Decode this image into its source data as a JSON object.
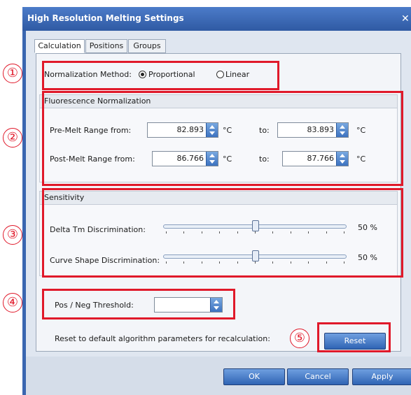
{
  "window": {
    "title": "High Resolution Melting Settings",
    "close": "✕"
  },
  "tabs": [
    {
      "label": "Calculation"
    },
    {
      "label": "Positions"
    },
    {
      "label": "Groups"
    }
  ],
  "normalization": {
    "label": "Normalization Method:",
    "options": [
      {
        "label": "Proportional",
        "selected": true
      },
      {
        "label": "Linear",
        "selected": false
      }
    ]
  },
  "fluorescence": {
    "header": "Fluorescence  Normalization",
    "premelt": {
      "label": "Pre-Melt Range from:",
      "from": "82.893",
      "unit": "°C",
      "to_label": "to:",
      "to": "83.893",
      "unit2": "°C"
    },
    "postmelt": {
      "label": "Post-Melt Range from:",
      "from": "86.766",
      "unit": "°C",
      "to_label": "to:",
      "to": "87.766",
      "unit2": "°C"
    }
  },
  "sensitivity": {
    "header": "Sensitivity",
    "delta_tm": {
      "label": "Delta Tm Discrimination:",
      "value_text": "50 %",
      "value": 0.5
    },
    "curve_shape": {
      "label": "Curve Shape Discrimination:",
      "value_text": "50 %",
      "value": 0.5
    }
  },
  "threshold": {
    "label": "Pos / Neg Threshold:",
    "value": ""
  },
  "reset": {
    "text": "Reset to default algorithm parameters for recalculation:",
    "button": "Reset"
  },
  "footer": {
    "ok": "OK",
    "cancel": "Cancel",
    "apply": "Apply"
  },
  "callouts": [
    "①",
    "②",
    "③",
    "④",
    "⑤"
  ],
  "colors": {
    "callout": "#e0192a",
    "titlebar": "#2f5aa3",
    "button": "#3c72c0"
  }
}
